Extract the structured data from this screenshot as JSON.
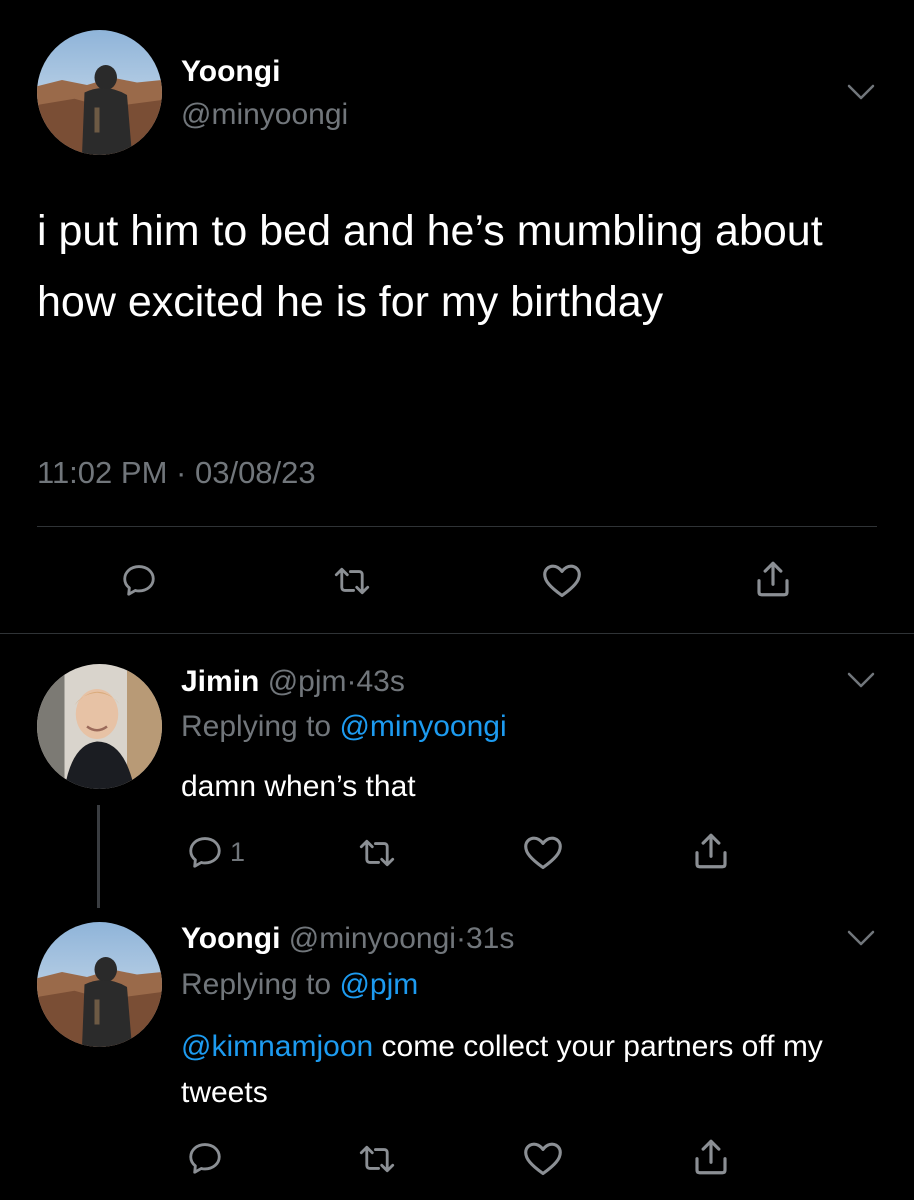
{
  "main_tweet": {
    "name": "Yoongi",
    "handle": "@minyoongi",
    "text": "i put him to bed and he’s mumbling about how excited he is for my birthday",
    "time": "11:02 PM",
    "separator": "·",
    "date": "03/08/23"
  },
  "replies": [
    {
      "name": "Jimin",
      "handle": "@pjm",
      "dot": "·",
      "age": "43s",
      "replying_prefix": "Replying to",
      "replying_to": "@minyoongi",
      "text_mention": "",
      "text": "damn when’s that",
      "reply_count": "1"
    },
    {
      "name": "Yoongi",
      "handle": "@minyoongi",
      "dot": "·",
      "age": "31s",
      "replying_prefix": "Replying to",
      "replying_to": "@pjm",
      "text_mention": "@kimnamjoon",
      "text": " come collect your partners off my tweets",
      "reply_count": ""
    }
  ],
  "icons": [
    "reply-icon",
    "retweet-icon",
    "like-icon",
    "share-icon",
    "chevron-down-icon"
  ],
  "colors": {
    "background": "#000000",
    "secondary_text": "#71767b",
    "link": "#1d9bf0",
    "divider": "#2f3336"
  }
}
